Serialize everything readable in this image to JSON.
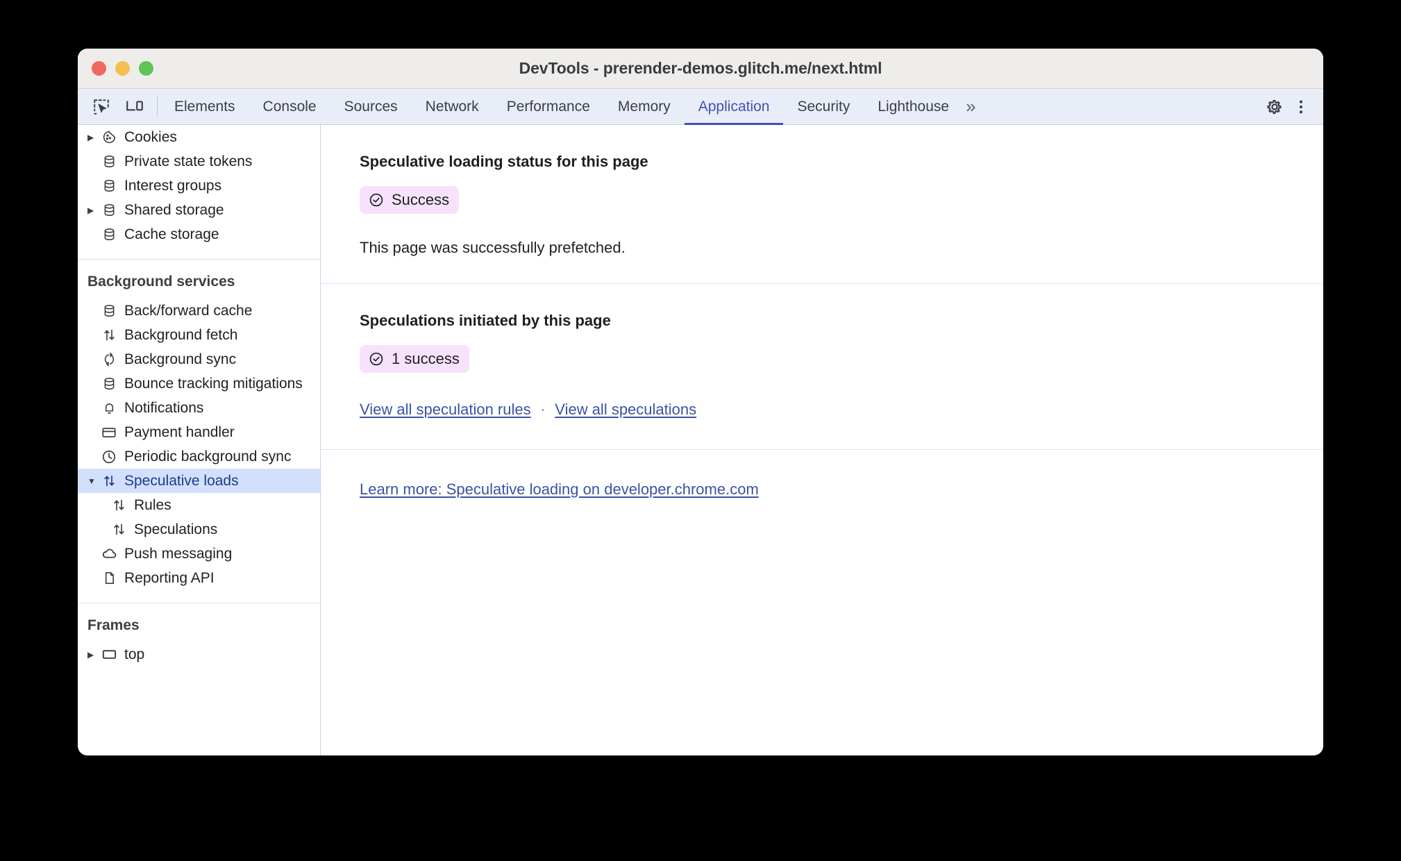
{
  "window": {
    "title": "DevTools - prerender-demos.glitch.me/next.html",
    "traffic_lights": [
      "close",
      "minimize",
      "zoom"
    ],
    "colors": {
      "close": "#ed6a5e",
      "minimize": "#f4bf4f",
      "zoom": "#61c454"
    }
  },
  "tabbar": {
    "left_icons": [
      {
        "name": "inspect-element-icon"
      },
      {
        "name": "device-toolbar-icon"
      }
    ],
    "tabs": [
      {
        "label": "Elements",
        "active": false
      },
      {
        "label": "Console",
        "active": false
      },
      {
        "label": "Sources",
        "active": false
      },
      {
        "label": "Network",
        "active": false
      },
      {
        "label": "Performance",
        "active": false
      },
      {
        "label": "Memory",
        "active": false
      },
      {
        "label": "Application",
        "active": true
      },
      {
        "label": "Security",
        "active": false
      },
      {
        "label": "Lighthouse",
        "active": false
      }
    ],
    "more_tabs_label": "»",
    "right_icons": [
      {
        "name": "settings-gear-icon"
      },
      {
        "name": "more-options-icon"
      }
    ],
    "accent_color": "#3f51b5",
    "background": "#e9edf7"
  },
  "sidebar": {
    "groups": [
      {
        "title": null,
        "items": [
          {
            "label": "Cookies",
            "icon": "cookie-icon",
            "expandable": true,
            "expanded": false,
            "indent": 0,
            "selected": false
          },
          {
            "label": "Private state tokens",
            "icon": "database-icon",
            "expandable": false,
            "expanded": false,
            "indent": 0,
            "selected": false
          },
          {
            "label": "Interest groups",
            "icon": "database-icon",
            "expandable": false,
            "expanded": false,
            "indent": 0,
            "selected": false
          },
          {
            "label": "Shared storage",
            "icon": "database-icon",
            "expandable": true,
            "expanded": false,
            "indent": 0,
            "selected": false
          },
          {
            "label": "Cache storage",
            "icon": "database-icon",
            "expandable": false,
            "expanded": false,
            "indent": 0,
            "selected": false
          }
        ]
      },
      {
        "title": "Background services",
        "items": [
          {
            "label": "Back/forward cache",
            "icon": "database-icon",
            "expandable": false,
            "expanded": false,
            "indent": 0,
            "selected": false
          },
          {
            "label": "Background fetch",
            "icon": "arrows-up-down-icon",
            "expandable": false,
            "expanded": false,
            "indent": 0,
            "selected": false
          },
          {
            "label": "Background sync",
            "icon": "sync-icon",
            "expandable": false,
            "expanded": false,
            "indent": 0,
            "selected": false
          },
          {
            "label": "Bounce tracking mitigations",
            "icon": "database-icon",
            "expandable": false,
            "expanded": false,
            "indent": 0,
            "selected": false
          },
          {
            "label": "Notifications",
            "icon": "bell-icon",
            "expandable": false,
            "expanded": false,
            "indent": 0,
            "selected": false
          },
          {
            "label": "Payment handler",
            "icon": "credit-card-icon",
            "expandable": false,
            "expanded": false,
            "indent": 0,
            "selected": false
          },
          {
            "label": "Periodic background sync",
            "icon": "clock-icon",
            "expandable": false,
            "expanded": false,
            "indent": 0,
            "selected": false
          },
          {
            "label": "Speculative loads",
            "icon": "arrows-up-down-icon",
            "expandable": true,
            "expanded": true,
            "indent": 0,
            "selected": true
          },
          {
            "label": "Rules",
            "icon": "arrows-up-down-icon",
            "expandable": false,
            "expanded": false,
            "indent": 1,
            "selected": false
          },
          {
            "label": "Speculations",
            "icon": "arrows-up-down-icon",
            "expandable": false,
            "expanded": false,
            "indent": 1,
            "selected": false
          },
          {
            "label": "Push messaging",
            "icon": "cloud-icon",
            "expandable": false,
            "expanded": false,
            "indent": 0,
            "selected": false
          },
          {
            "label": "Reporting API",
            "icon": "document-icon",
            "expandable": false,
            "expanded": false,
            "indent": 0,
            "selected": false
          }
        ]
      },
      {
        "title": "Frames",
        "items": [
          {
            "label": "top",
            "icon": "frame-icon",
            "expandable": true,
            "expanded": false,
            "indent": 0,
            "selected": false
          }
        ]
      }
    ],
    "selected_color": "#d3e0fd"
  },
  "main": {
    "status_section": {
      "title": "Speculative loading status for this page",
      "badge": {
        "label": "Success",
        "icon": "check-circle-icon",
        "background": "#f6e3fb"
      },
      "description": "This page was successfully prefetched."
    },
    "speculations_section": {
      "title": "Speculations initiated by this page",
      "badge": {
        "label": "1 success",
        "icon": "check-circle-icon",
        "background": "#f6e3fb"
      },
      "links": [
        {
          "label": "View all speculation rules"
        },
        {
          "label": "View all speculations"
        }
      ],
      "separator": "·"
    },
    "learn_more": {
      "label": "Learn more: Speculative loading on developer.chrome.com"
    },
    "link_color": "#3b52a4"
  }
}
